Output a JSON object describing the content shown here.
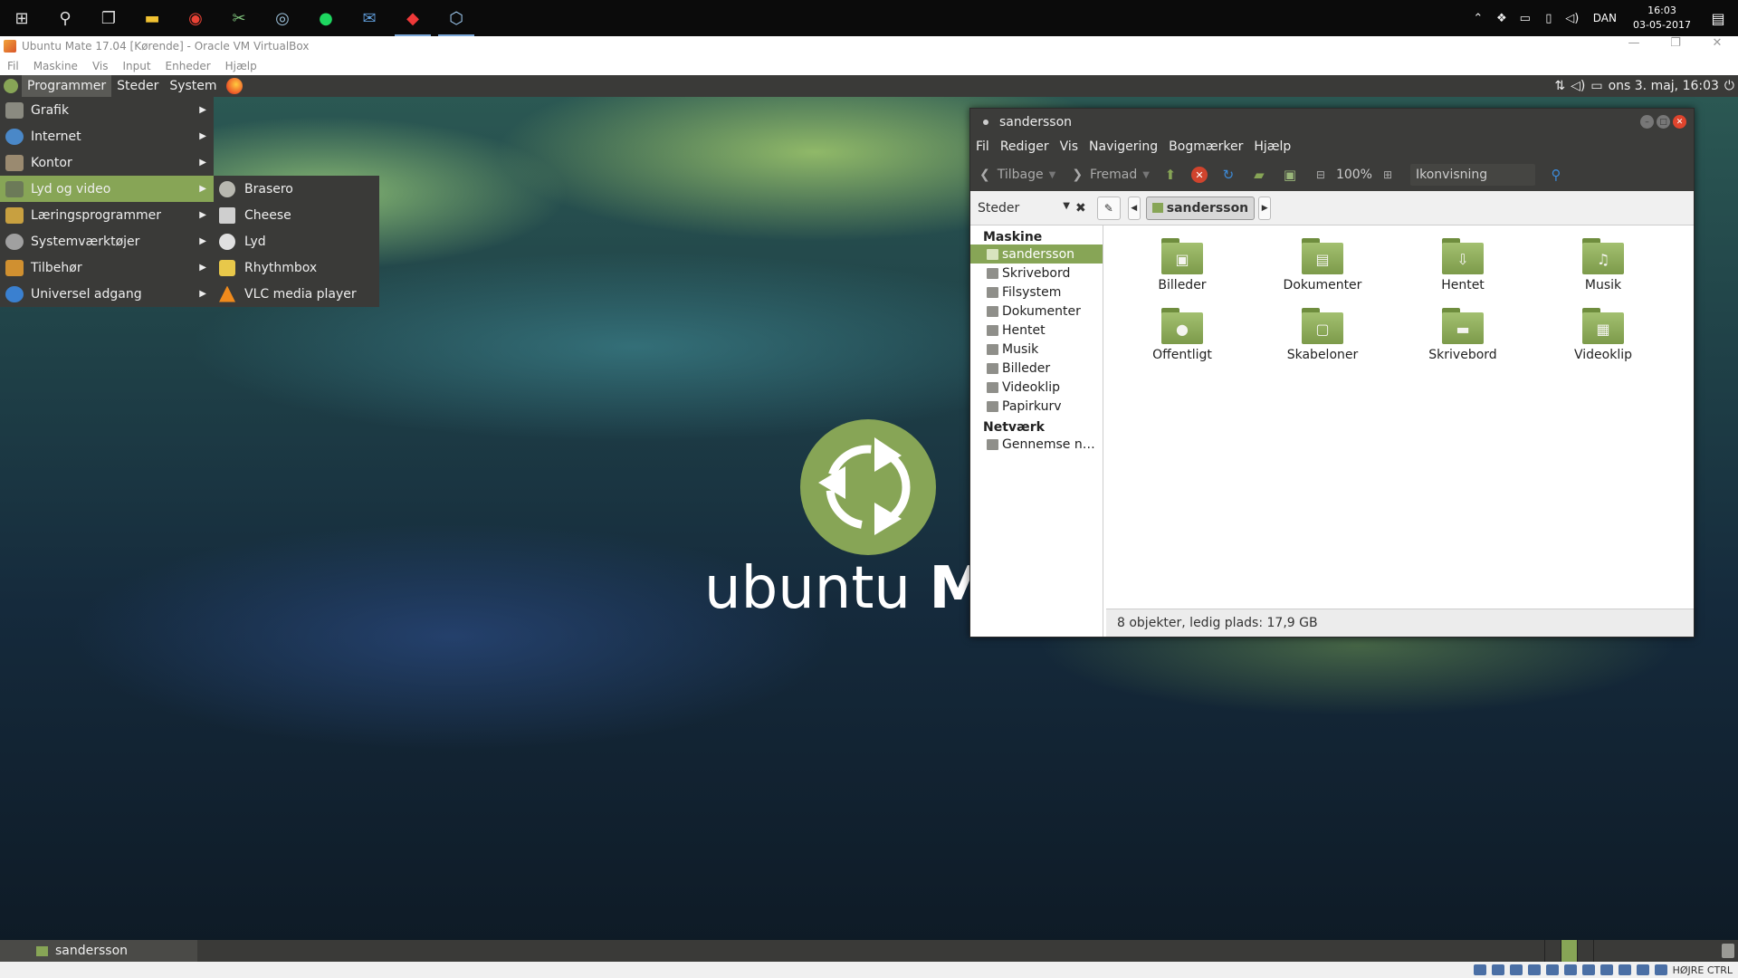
{
  "win_taskbar": {
    "apps": [
      {
        "name": "start",
        "icon": "windows-logo-icon"
      },
      {
        "name": "search",
        "icon": "search-icon"
      },
      {
        "name": "task-view",
        "icon": "task-view-icon"
      },
      {
        "name": "file-explorer",
        "icon": "folder-icon"
      },
      {
        "name": "chrome",
        "icon": "chrome-icon"
      },
      {
        "name": "snipping",
        "icon": "scissors-icon"
      },
      {
        "name": "steam",
        "icon": "steam-icon"
      },
      {
        "name": "spotify",
        "icon": "spotify-icon"
      },
      {
        "name": "thunderbird",
        "icon": "mail-icon"
      },
      {
        "name": "vivaldi",
        "icon": "vivaldi-icon"
      },
      {
        "name": "virtualbox",
        "icon": "virtualbox-icon"
      }
    ],
    "language": "DAN",
    "time": "16:03",
    "date": "03-05-2017"
  },
  "vbox": {
    "title": "Ubuntu Mate 17.04 [Kørende] - Oracle VM VirtualBox",
    "menu": [
      "Fil",
      "Maskine",
      "Vis",
      "Input",
      "Enheder",
      "Hjælp"
    ],
    "status_right": "HØJRE CTRL"
  },
  "mate_top": {
    "menus": [
      "Programmer",
      "Steder",
      "System"
    ],
    "clock": "ons  3. maj, 16:03"
  },
  "app_menu": {
    "items": [
      {
        "label": "Grafik",
        "icon": "graphics-icon",
        "color": "#8a8a80"
      },
      {
        "label": "Internet",
        "icon": "globe-icon",
        "color": "#4a88c8"
      },
      {
        "label": "Kontor",
        "icon": "office-icon",
        "color": "#9a8a70"
      },
      {
        "label": "Lyd og video",
        "icon": "multimedia-icon",
        "color": "#6c7a58"
      },
      {
        "label": "Læringsprogrammer",
        "icon": "education-icon",
        "color": "#c8a040"
      },
      {
        "label": "Systemværktøjer",
        "icon": "gear-icon",
        "color": "#a0a0a0"
      },
      {
        "label": "Tilbehør",
        "icon": "accessories-icon",
        "color": "#d09030"
      },
      {
        "label": "Universel adgang",
        "icon": "accessibility-icon",
        "color": "#3a80d0"
      }
    ],
    "submenu": [
      {
        "label": "Brasero",
        "icon": "disc-icon",
        "color": "#b8b8b0"
      },
      {
        "label": "Cheese",
        "icon": "camera-icon",
        "color": "#cfcfcf"
      },
      {
        "label": "Lyd",
        "icon": "audio-icon",
        "color": "#e0e0e0"
      },
      {
        "label": "Rhythmbox",
        "icon": "speaker-icon",
        "color": "#e8c84a"
      },
      {
        "label": "VLC media player",
        "icon": "vlc-cone-icon",
        "color": "#f08a1c"
      }
    ]
  },
  "desktop_logo": {
    "word1": "ubuntu",
    "word2": "MATE"
  },
  "caja": {
    "title": "sandersson",
    "menu": [
      "Fil",
      "Rediger",
      "Vis",
      "Navigering",
      "Bogmærker",
      "Hjælp"
    ],
    "toolbar": {
      "back": "Tilbage",
      "forward": "Fremad",
      "zoom": "100%",
      "view": "Ikonvisning"
    },
    "places_label": "Steder",
    "path": "sandersson",
    "sidebar": {
      "machine_header": "Maskine",
      "machine_items": [
        "sandersson",
        "Skrivebord",
        "Filsystem",
        "Dokumenter",
        "Hentet",
        "Musik",
        "Billeder",
        "Videoklip",
        "Papirkurv"
      ],
      "network_header": "Netværk",
      "network_items": [
        "Gennemse n…"
      ]
    },
    "files": [
      {
        "label": "Billeder",
        "glyph": "▣"
      },
      {
        "label": "Dokumenter",
        "glyph": "▤"
      },
      {
        "label": "Hentet",
        "glyph": "⇩"
      },
      {
        "label": "Musik",
        "glyph": "♫"
      },
      {
        "label": "Offentligt",
        "glyph": "●"
      },
      {
        "label": "Skabeloner",
        "glyph": "▢"
      },
      {
        "label": "Skrivebord",
        "glyph": "▬"
      },
      {
        "label": "Videoklip",
        "glyph": "▦"
      }
    ],
    "status": "8 objekter, ledig plads: 17,9 GB"
  },
  "mate_bottom": {
    "task": "sandersson"
  },
  "accent": "#87a556"
}
